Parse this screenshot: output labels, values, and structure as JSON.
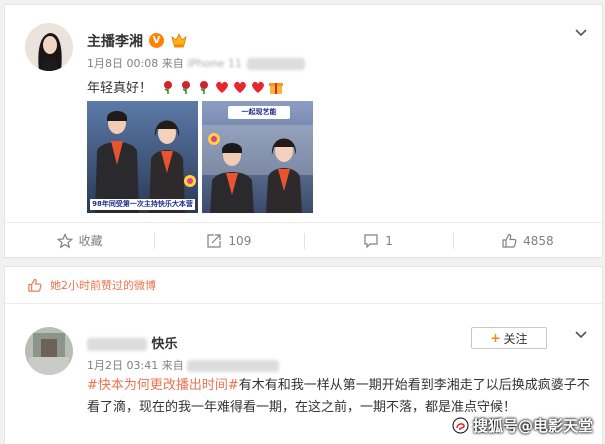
{
  "post1": {
    "author": "主播李湘",
    "time": "1月8日 00:08",
    "source_prefix": "来自",
    "source_partial": "iPhone 11",
    "text": "年轻真好！",
    "emoji_icons": [
      "rose-emoji",
      "rose-emoji",
      "rose-emoji",
      "heart-emoji",
      "heart-emoji",
      "heart-emoji",
      "gift-emoji"
    ],
    "photo1_caption": "98年同受第一次主持快乐大本营",
    "photo2_caption": "一起现艺能",
    "actions": {
      "favorite_label": "收藏",
      "repost_count": "109",
      "comment_count": "1",
      "like_count": "4858"
    }
  },
  "post2": {
    "liked_notice": "她2小时前赞过的微博",
    "author_partial": "快乐",
    "time": "1月2日 03:41",
    "source_prefix": "来自",
    "follow_label": "关注",
    "topic": "#快本为何更改播出时间#",
    "text": "有木有和我一样从第一期开始看到李湘走了以后换成疯婆子不看了滴，现在的我一年难得看一期，在这之前，一期不落，都是准点守候！"
  },
  "watermark": "搜狐号@电影天堂",
  "colors": {
    "accent": "#eb7350",
    "vip_orange": "#ff8200",
    "meta_gray": "#808080",
    "background": "#f1f1f1"
  }
}
